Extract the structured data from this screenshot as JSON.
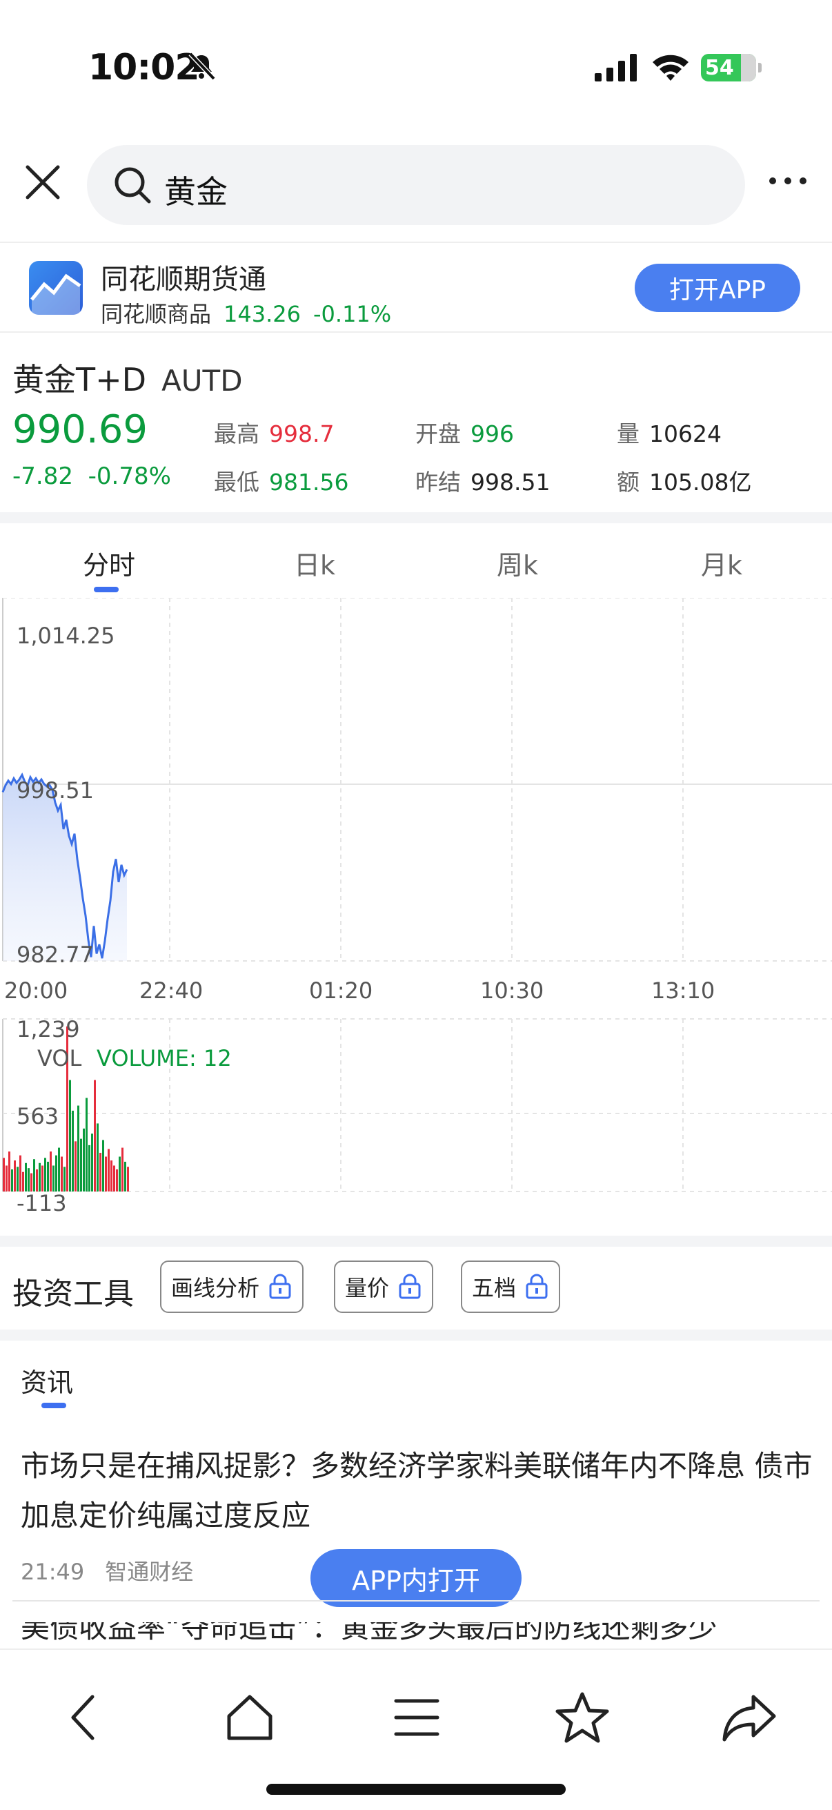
{
  "status": {
    "time": "10:02",
    "battery": "54"
  },
  "search": {
    "query": "黄金"
  },
  "banner": {
    "app_name": "同花顺期货通",
    "sub_label": "同花顺商品",
    "sub_value": "143.26",
    "sub_change": "-0.11%",
    "open_label": "打开APP"
  },
  "quote": {
    "name": "黄金T+D",
    "code": "AUTD",
    "price": "990.69",
    "change": "-7.82",
    "change_pct": "-0.78%",
    "high_label": "最高",
    "high": "998.7",
    "low_label": "最低",
    "low": "981.56",
    "open_label": "开盘",
    "open": "996",
    "prev_label": "昨结",
    "prev": "998.51",
    "vol_label": "量",
    "vol": "10624",
    "amt_label": "额",
    "amt": "105.08亿"
  },
  "chart_tabs": [
    "分时",
    "日k",
    "周k",
    "月k"
  ],
  "chart_data": [
    {
      "type": "line",
      "title": "",
      "y_ticks": [
        "1,014.25",
        "998.51",
        "982.77"
      ],
      "x_ticks": [
        "20:00",
        "22:40",
        "01:20",
        "10:30",
        "13:10"
      ],
      "ylim": [
        982.77,
        1014.25
      ],
      "reference": 998.51,
      "series": [
        {
          "values": [
            997.4,
            998.0,
            998.4,
            998.1,
            998.6,
            998.2,
            998.5,
            998.9,
            998.3,
            998.0,
            998.7,
            998.3,
            998.6,
            998.2,
            998.5,
            998.1,
            997.9,
            998.0,
            997.6,
            996.5,
            995.8,
            996.3,
            994.2,
            995.0,
            993.6,
            992.9,
            993.8,
            991.6,
            990.0,
            988.2,
            986.7,
            984.6,
            983.1,
            985.8,
            983.4,
            984.2,
            983.0,
            984.5,
            986.4,
            988.0,
            990.5,
            991.6,
            989.6,
            991.1,
            990.2,
            990.7
          ]
        }
      ],
      "grid": true
    },
    {
      "type": "bar",
      "title": "",
      "label": "VOL",
      "legend": "VOLUME: 12",
      "y_ticks": [
        "1,239",
        "563",
        "-113"
      ],
      "ylim": [
        -113,
        1239
      ],
      "values": [
        150,
        90,
        200,
        60,
        130,
        80,
        170,
        40,
        110,
        70,
        30,
        140,
        60,
        110,
        90,
        150,
        120,
        200,
        90,
        170,
        230,
        160,
        80,
        1180,
        760,
        520,
        280,
        560,
        300,
        380,
        620,
        250,
        340,
        760,
        420,
        190,
        290,
        160,
        220,
        130,
        90,
        60,
        160,
        230,
        120,
        80
      ],
      "colors": {
        "up": "#e52d3c",
        "down": "#0a9b3d"
      }
    }
  ],
  "tools": {
    "title": "投资工具",
    "items": [
      "画线分析",
      "量价",
      "五档"
    ]
  },
  "news": {
    "tab": "资讯",
    "headline": "市场只是在捕风捉影？多数经济学家料美联储年内不降息 债市加息定价纯属过度反应",
    "time": "21:49",
    "source": "智通财经",
    "open_in_app": "APP内打开",
    "headline2": "美债收益率“夺命追击”：黄金多头最后的防线还剩多少"
  }
}
